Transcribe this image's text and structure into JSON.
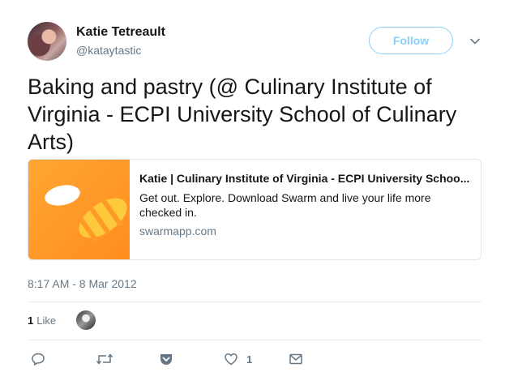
{
  "author": {
    "name": "Katie Tetreault",
    "handle": "@kataytastic"
  },
  "follow_label": "Follow",
  "tweet_text": "Baking and pastry (@ Culinary Institute of Virginia - ECPI University School of Culinary Arts)",
  "card": {
    "title": "Katie | Culinary Institute of Virginia - ECPI University Schoo...",
    "description": "Get out. Explore. Download Swarm and live your life more checked in.",
    "domain": "swarmapp.com",
    "image_icon": "swarm-bee-logo",
    "image_color": "#ff9a28"
  },
  "timestamp": "8:17 AM - 8 Mar 2012",
  "stats": {
    "likes_count": "1",
    "likes_label": "Like"
  },
  "actions": {
    "reply_icon": "reply-icon",
    "retweet_icon": "retweet-icon",
    "pocket_icon": "pocket-icon",
    "like_icon": "heart-icon",
    "like_count": "1",
    "dm_icon": "envelope-icon"
  },
  "colors": {
    "accent": "#1da1f2",
    "muted": "#657786"
  }
}
